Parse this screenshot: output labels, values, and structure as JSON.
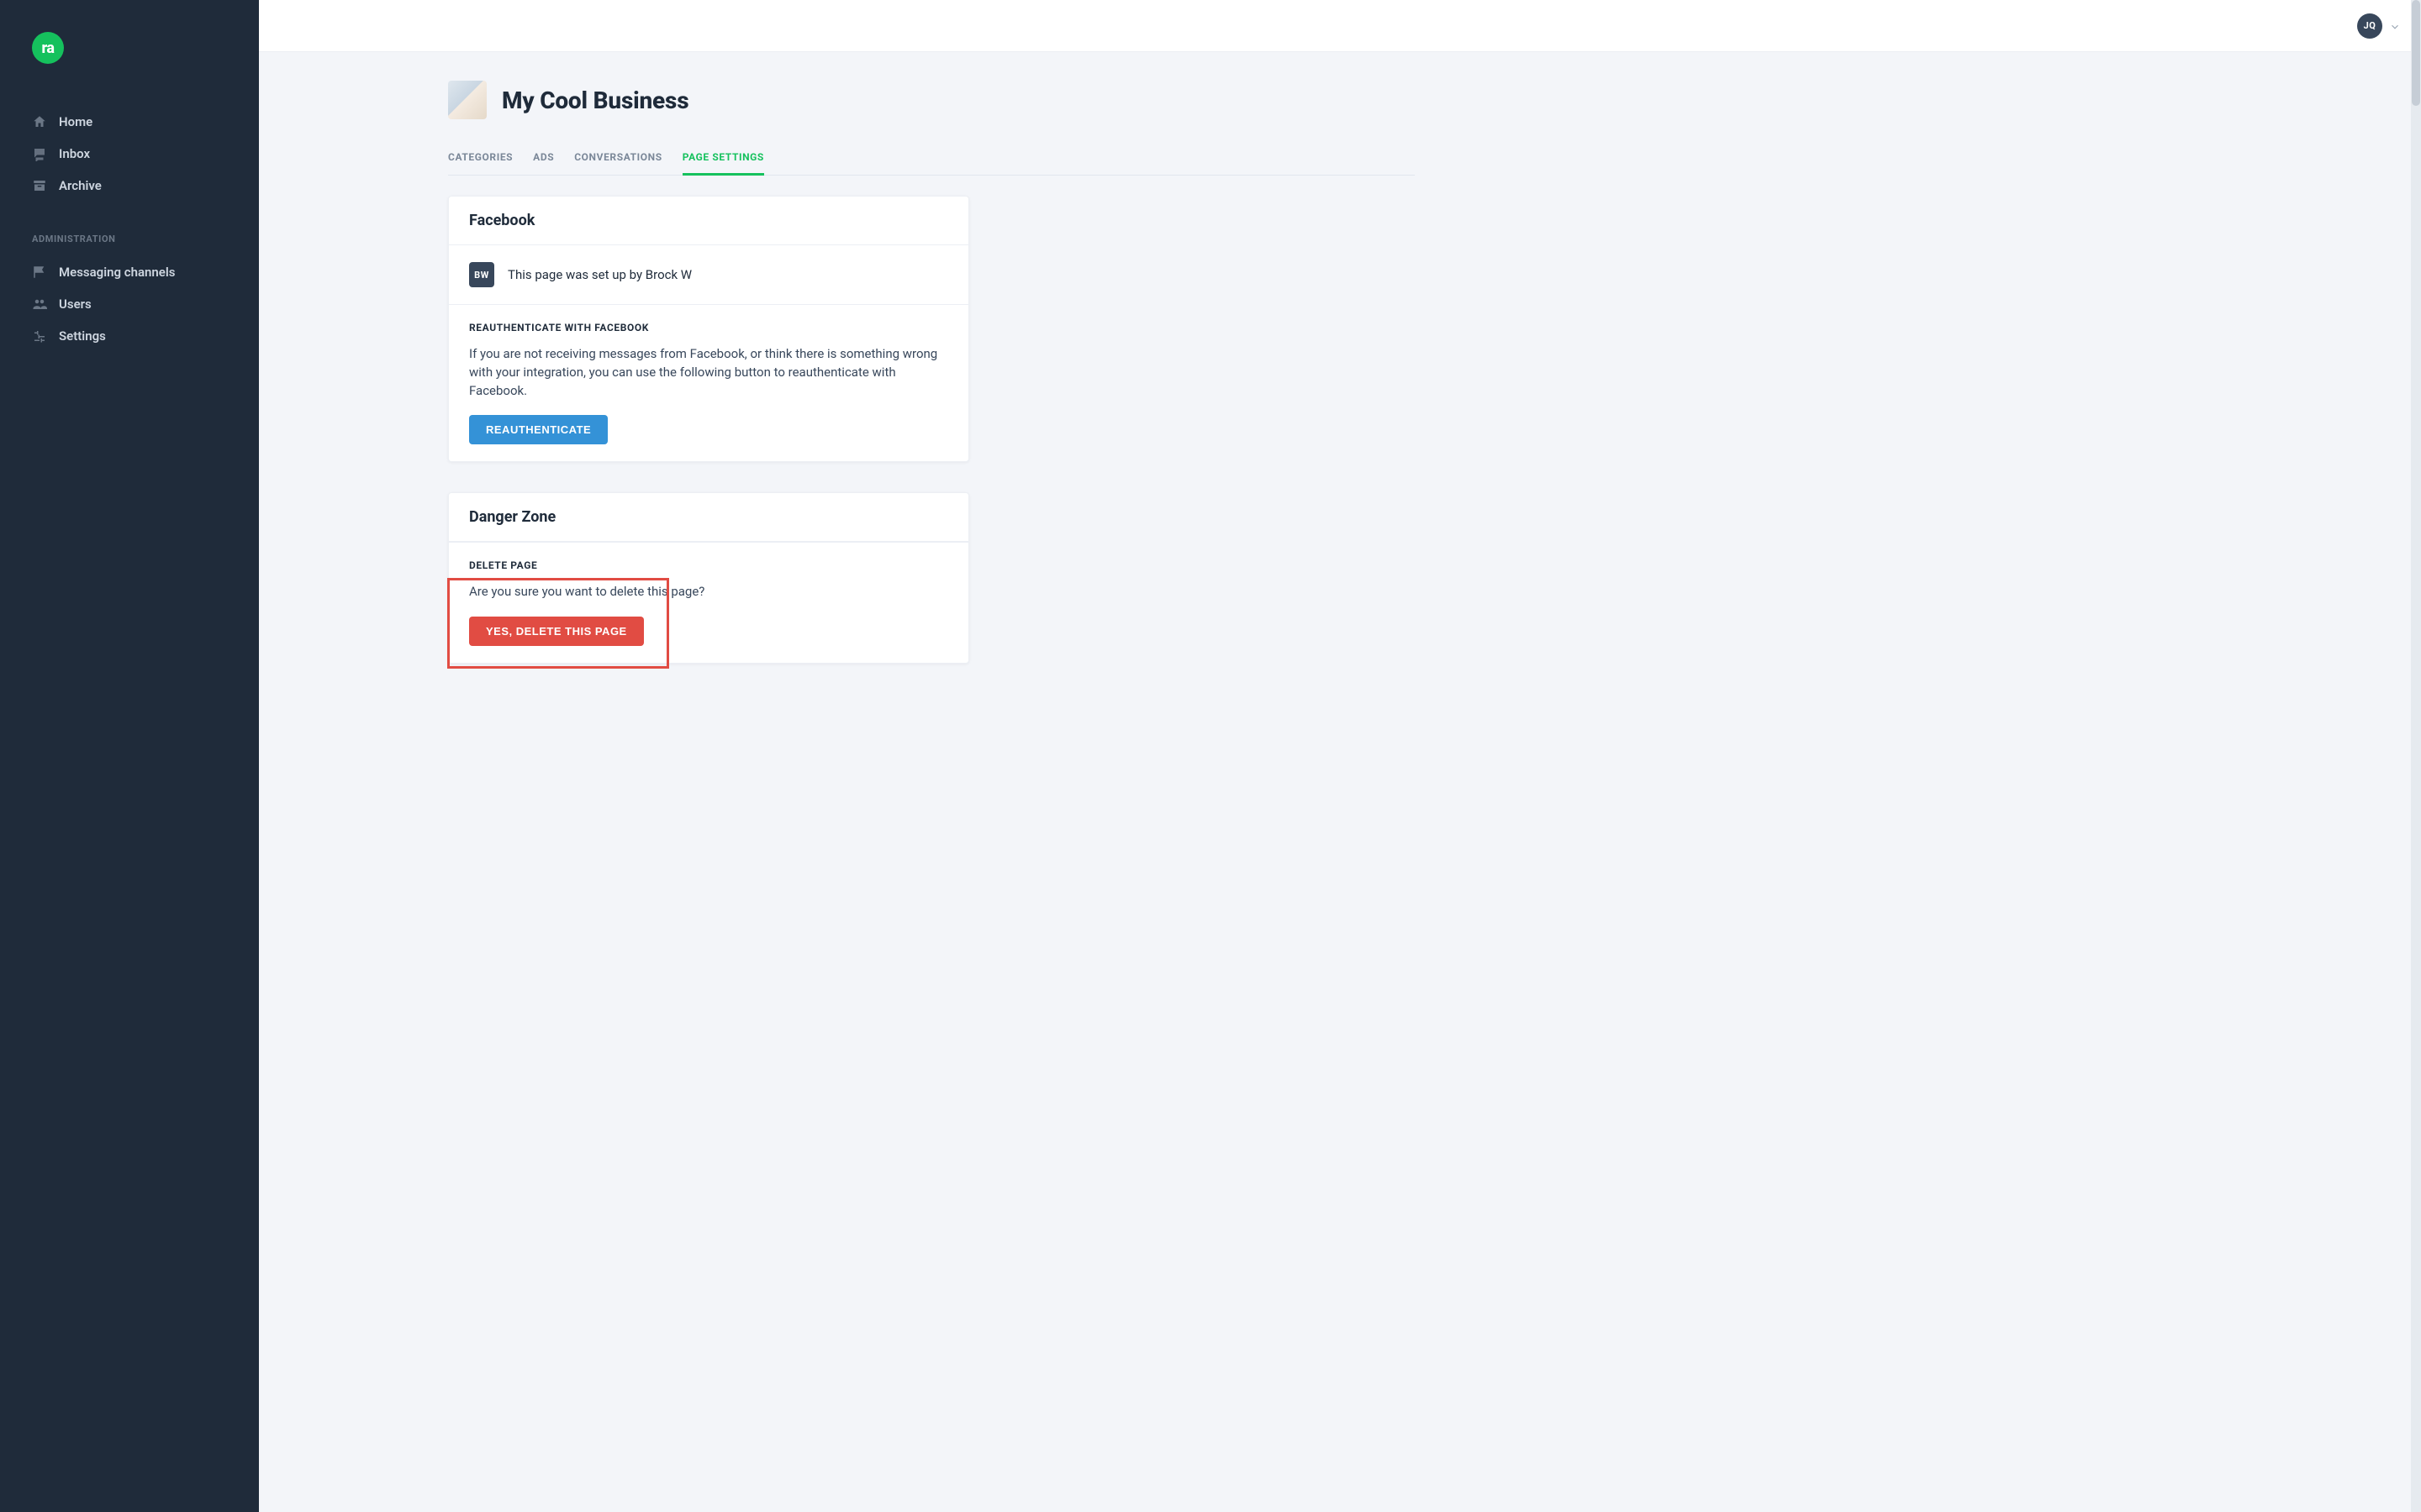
{
  "brand": {
    "logo_text": "ra"
  },
  "sidebar": {
    "primary": [
      {
        "label": "Home",
        "icon": "home-icon"
      },
      {
        "label": "Inbox",
        "icon": "chat-icon"
      },
      {
        "label": "Archive",
        "icon": "archive-icon"
      }
    ],
    "admin_heading": "Administration",
    "admin": [
      {
        "label": "Messaging channels",
        "icon": "flag-icon"
      },
      {
        "label": "Users",
        "icon": "users-icon"
      },
      {
        "label": "Settings",
        "icon": "sliders-icon"
      }
    ]
  },
  "topbar": {
    "user_initials": "JQ"
  },
  "page": {
    "title": "My Cool Business"
  },
  "tabs": [
    {
      "label": "Categories",
      "active": false
    },
    {
      "label": "Ads",
      "active": false
    },
    {
      "label": "Conversations",
      "active": false
    },
    {
      "label": "Page Settings",
      "active": true
    }
  ],
  "facebook_card": {
    "title": "Facebook",
    "setup_initials": "BW",
    "setup_text": "This page was set up by Brock W",
    "reauth_heading": "Reauthenticate with Facebook",
    "reauth_body": "If you are not receiving messages from Facebook, or think there is something wrong with your integration, you can use the following button to reauthenticate with Facebook.",
    "reauth_button": "Reauthenticate"
  },
  "danger_card": {
    "title": "Danger Zone",
    "delete_heading": "Delete Page",
    "delete_body": "Are you sure you want to delete this page?",
    "delete_button": "Yes, delete this page"
  },
  "colors": {
    "accent_green": "#15c15d",
    "accent_blue": "#3492d7",
    "danger_red": "#e14c43",
    "sidebar_bg": "#1f2b3a",
    "page_bg": "#f3f5f9"
  }
}
